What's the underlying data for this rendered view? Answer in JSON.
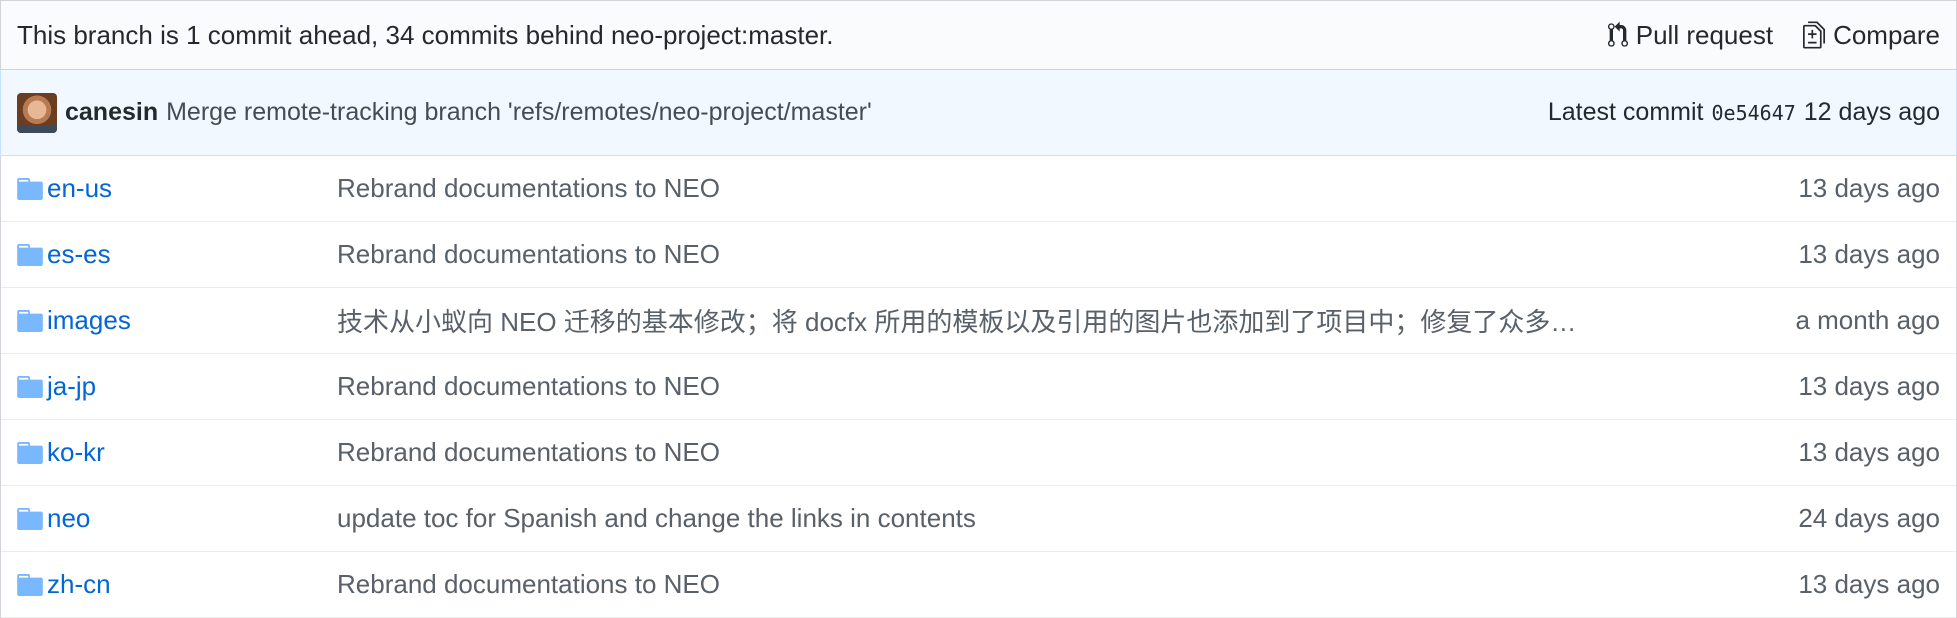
{
  "branch_bar": {
    "status_text": "This branch is 1 commit ahead, 34 commits behind neo-project:master.",
    "pull_request_label": "Pull request",
    "compare_label": "Compare"
  },
  "latest_commit": {
    "author": "canesin",
    "message": "Merge remote-tracking branch 'refs/remotes/neo-project/master'",
    "prefix": "Latest commit",
    "sha": "0e54647",
    "age": "12 days ago"
  },
  "files": [
    {
      "name": "en-us",
      "message": "Rebrand documentations to NEO",
      "age": "13 days ago"
    },
    {
      "name": "es-es",
      "message": "Rebrand documentations to NEO",
      "age": "13 days ago"
    },
    {
      "name": "images",
      "message": "技术从小蚁向 NEO 迁移的基本修改；将 docfx 所用的模板以及引用的图片也添加到了项目中；修复了众多…",
      "age": "a month ago"
    },
    {
      "name": "ja-jp",
      "message": "Rebrand documentations to NEO",
      "age": "13 days ago"
    },
    {
      "name": "ko-kr",
      "message": "Rebrand documentations to NEO",
      "age": "13 days ago"
    },
    {
      "name": "neo",
      "message": "update toc for Spanish and change the links in contents",
      "age": "24 days ago"
    },
    {
      "name": "zh-cn",
      "message": "Rebrand documentations to NEO",
      "age": "13 days ago"
    }
  ],
  "colors": {
    "link": "#0366d6",
    "folder_icon": "#79b8ff",
    "commit_bar_bg": "#f1f8ff"
  },
  "icons": {
    "pull_request": "git-pull-request-icon",
    "compare": "diff-icon",
    "folder": "file-directory-icon"
  }
}
